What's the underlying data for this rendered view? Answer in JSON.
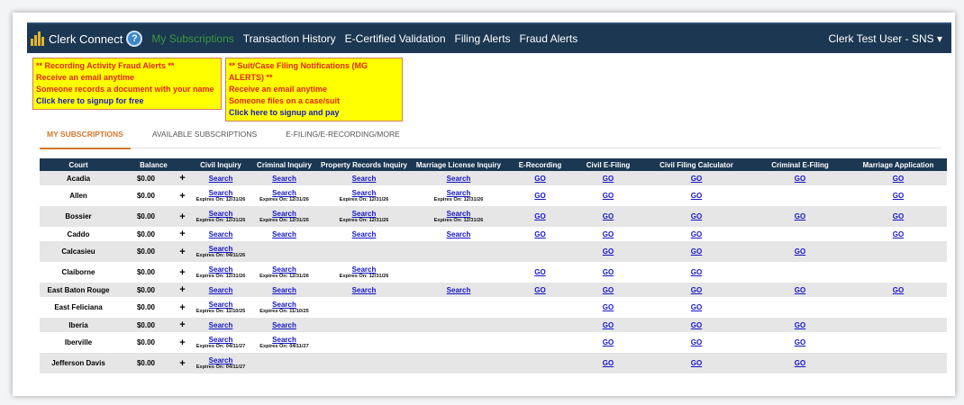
{
  "nav": {
    "app_name": "Clerk Connect",
    "help": "?",
    "items": [
      "My Subscriptions",
      "Transaction History",
      "E-Certified Validation",
      "Filing Alerts",
      "Fraud Alerts"
    ],
    "user": "Clerk Test User - SNS ▾"
  },
  "alerts": [
    {
      "title": "** Recording Activity Fraud Alerts **",
      "l1": "Receive an email anytime",
      "l2": "Someone records a document with your name",
      "link": "Click here to signup for free"
    },
    {
      "title": "** Suit/Case Filing Notifications (MG ALERTS) **",
      "l1": "Receive an email anytime",
      "l2": "Someone files on a case/suit",
      "link": "Click here to signup and pay"
    }
  ],
  "tabs": [
    "MY SUBSCRIPTIONS",
    "AVAILABLE SUBSCRIPTIONS",
    "E-FILING/E-RECORDING/MORE"
  ],
  "columns": [
    "Court",
    "Balance",
    "Civil Inquiry",
    "Criminal Inquiry",
    "Property Records Inquiry",
    "Marriage License Inquiry",
    "E-Recording",
    "Civil E-Filing",
    "Civil Filing Calculator",
    "Criminal E-Filing",
    "Marriage Application"
  ],
  "link_search": "Search",
  "link_go": "GO",
  "plus": "+",
  "rows": [
    {
      "court": "Acadia",
      "balance": "$0.00",
      "civil": "",
      "criminal": "",
      "property": "",
      "marriage": "",
      "erec": true,
      "cefile": true,
      "calc": true,
      "crimefile": true,
      "mapp": true
    },
    {
      "court": "Allen",
      "balance": "$0.00",
      "civil": "Expires On: 12/31/26",
      "criminal": "Expires On: 12/31/26",
      "property": "Expires On: 12/31/26",
      "marriage": "Expires On: 12/31/26",
      "erec": true,
      "cefile": true,
      "calc": true,
      "crimefile": false,
      "mapp": true
    },
    {
      "court": "Bossier",
      "balance": "$0.00",
      "civil": "Expires On: 12/31/26",
      "criminal": "Expires On: 12/31/26",
      "property": "Expires On: 12/31/26",
      "marriage": "Expires On: 12/31/26",
      "erec": true,
      "cefile": true,
      "calc": true,
      "crimefile": true,
      "mapp": true
    },
    {
      "court": "Caddo",
      "balance": "$0.00",
      "civil": "",
      "criminal": "",
      "property": "",
      "marriage": "",
      "erec": true,
      "cefile": true,
      "calc": true,
      "crimefile": false,
      "mapp": true
    },
    {
      "court": "Calcasieu",
      "balance": "$0.00",
      "civil": "Expires On: 04/11/26",
      "criminal": null,
      "property": null,
      "marriage": null,
      "erec": false,
      "cefile": true,
      "calc": true,
      "crimefile": true,
      "mapp": false
    },
    {
      "court": "Claiborne",
      "balance": "$0.00",
      "civil": "Expires On: 12/31/26",
      "criminal": "Expires On: 12/31/26",
      "property": "Expires On: 12/31/26",
      "marriage": null,
      "erec": true,
      "cefile": true,
      "calc": true,
      "crimefile": false,
      "mapp": false
    },
    {
      "court": "East Baton Rouge",
      "balance": "$0.00",
      "civil": "",
      "criminal": "",
      "property": "",
      "marriage": "",
      "erec": true,
      "cefile": true,
      "calc": true,
      "crimefile": true,
      "mapp": true
    },
    {
      "court": "East Feliciana",
      "balance": "$0.00",
      "civil": "Expires On: 11/10/25",
      "criminal": "Expires On: 11/10/25",
      "property": null,
      "marriage": null,
      "erec": false,
      "cefile": true,
      "calc": true,
      "crimefile": false,
      "mapp": false
    },
    {
      "court": "Iberia",
      "balance": "$0.00",
      "civil": "",
      "criminal": "",
      "property": null,
      "marriage": null,
      "erec": false,
      "cefile": true,
      "calc": true,
      "crimefile": true,
      "mapp": false
    },
    {
      "court": "Iberville",
      "balance": "$0.00",
      "civil": "Expires On: 04/11/27",
      "criminal": "Expires On: 04/11/27",
      "property": null,
      "marriage": null,
      "erec": false,
      "cefile": true,
      "calc": true,
      "crimefile": true,
      "mapp": false
    },
    {
      "court": "Jefferson Davis",
      "balance": "$0.00",
      "civil": "Expires On: 04/11/27",
      "criminal": null,
      "property": null,
      "marriage": null,
      "erec": false,
      "cefile": true,
      "calc": true,
      "crimefile": true,
      "mapp": false
    }
  ]
}
